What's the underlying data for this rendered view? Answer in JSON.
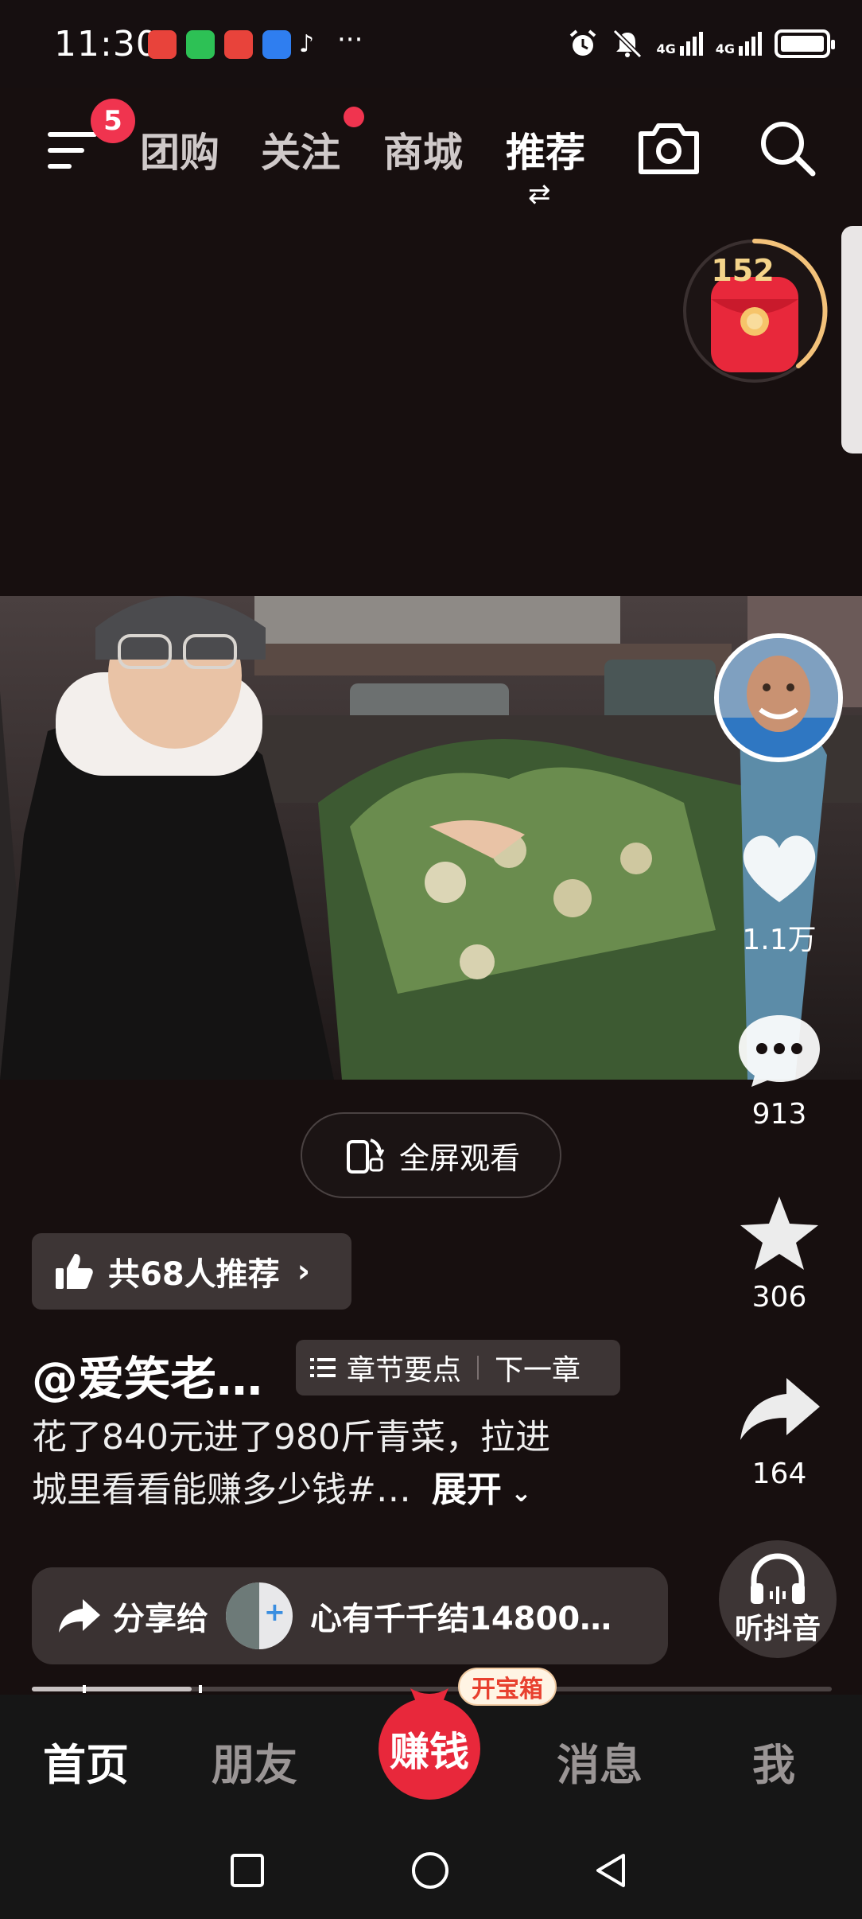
{
  "status_bar": {
    "time": "11:30",
    "more": "···",
    "signal1": "4G",
    "signal2": "4G"
  },
  "top_nav": {
    "menu_badge": "5",
    "tabs": [
      "团购",
      "关注",
      "商城",
      "推荐"
    ],
    "active_tab": "推荐",
    "swap_glyph": "⇄"
  },
  "red_packet": {
    "count": "152"
  },
  "actions": {
    "likes": "1.1万",
    "comments": "913",
    "favorites": "306",
    "shares": "164"
  },
  "fullscreen": {
    "label": "全屏观看"
  },
  "recommend_chip": {
    "label": "共68人推荐"
  },
  "author": {
    "name": "@爱笑老…"
  },
  "chapter": {
    "label": "章节要点",
    "next": "下一章"
  },
  "caption": {
    "line1": "花了840元进了980斤青菜，拉进",
    "line2": "城里看看能赚多少钱#…",
    "expand": "展开"
  },
  "share_bar": {
    "label": "分享给",
    "target": "心有千千结14800…"
  },
  "listen": {
    "label": "听抖音"
  },
  "bottom_nav": {
    "home": "首页",
    "friends": "朋友",
    "earn": "赚钱",
    "treasure": "开宝箱",
    "messages": "消息",
    "me": "我"
  },
  "playback_progress": 0.2,
  "colors": {
    "background": "#170f0f",
    "accent_red": "#f0344f",
    "chip_bg": "#3d3535"
  }
}
